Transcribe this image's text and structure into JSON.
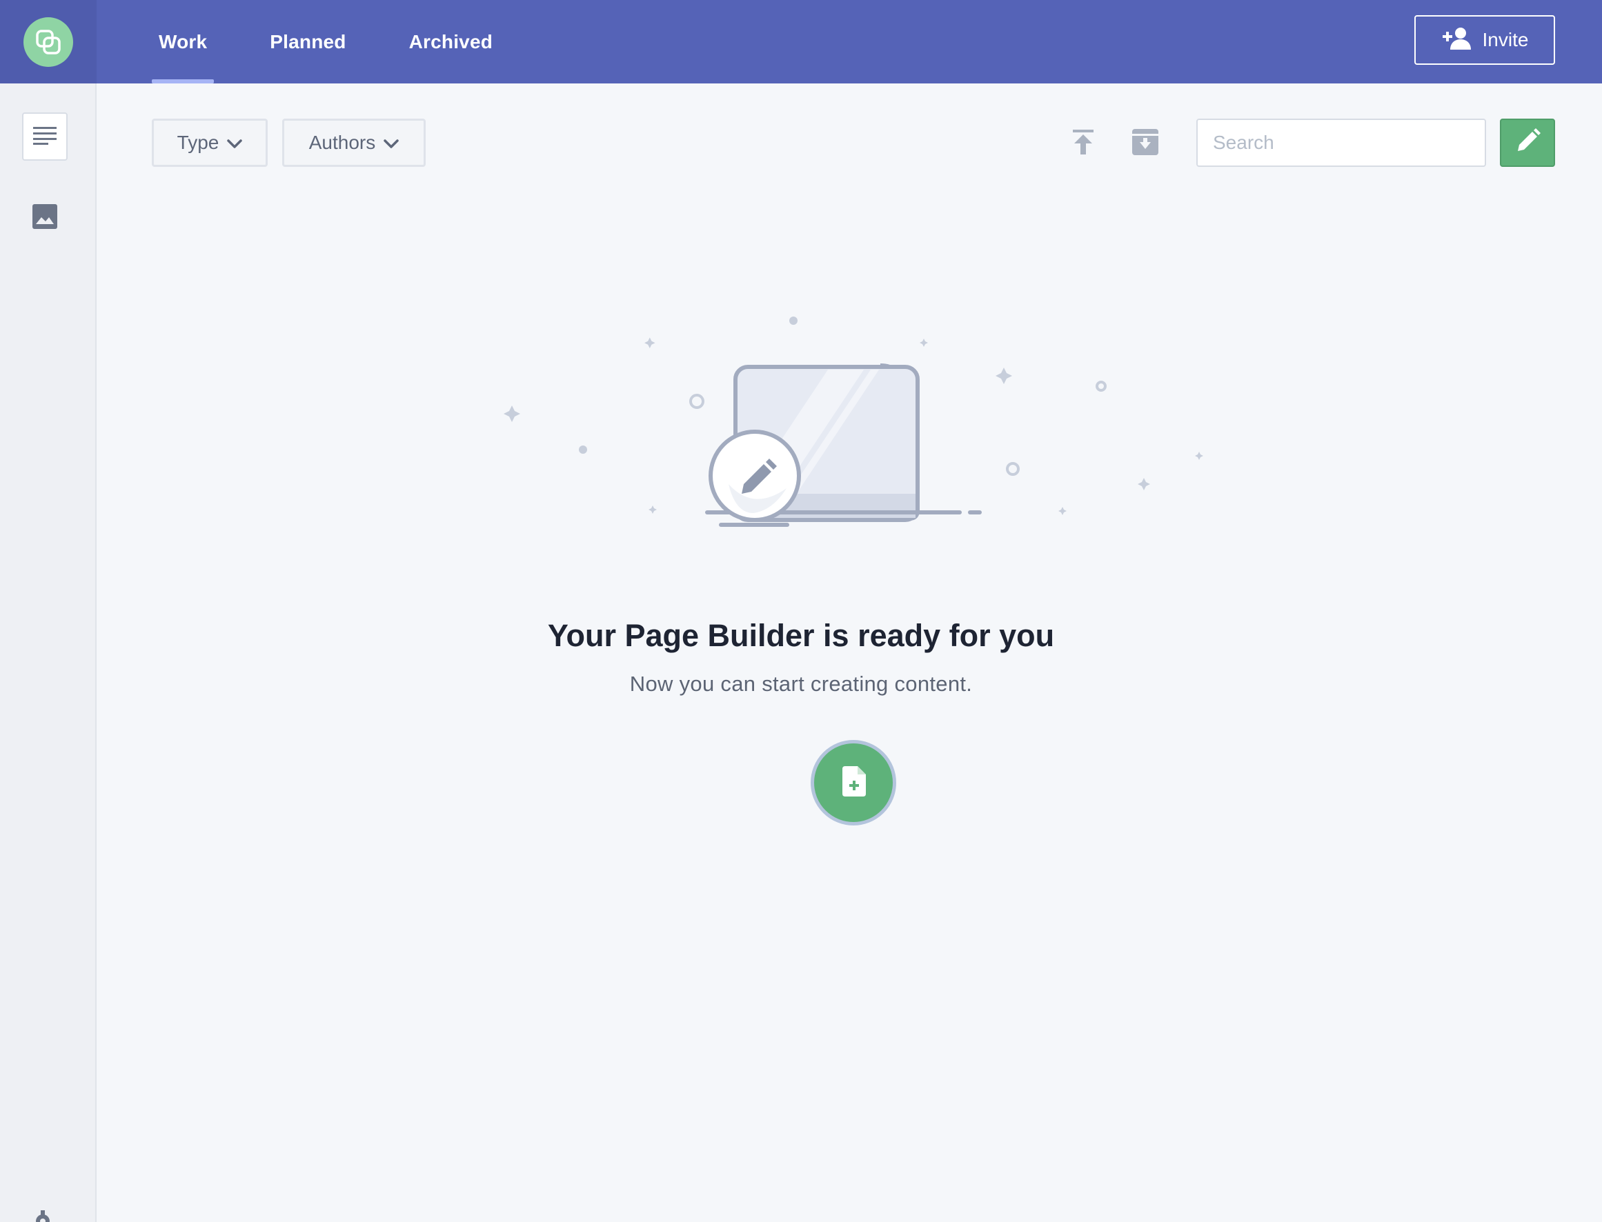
{
  "header": {
    "logo_icon": "brand-logo-icon",
    "tabs": [
      {
        "label": "Work",
        "active": true
      },
      {
        "label": "Planned",
        "active": false
      },
      {
        "label": "Archived",
        "active": false
      }
    ],
    "invite_label": "Invite",
    "invite_icon": "add-user-icon"
  },
  "sidebar": {
    "items": [
      {
        "icon": "list-icon",
        "active": true
      },
      {
        "icon": "image-icon",
        "active": false
      }
    ],
    "bottom_icon": "gear-icon"
  },
  "toolbar": {
    "filters": [
      {
        "label": "Type",
        "icon": "chevron-down-icon"
      },
      {
        "label": "Authors",
        "icon": "chevron-down-icon"
      }
    ],
    "actions": [
      "publish-icon",
      "archive-icon"
    ],
    "search": {
      "placeholder": "Search",
      "value": ""
    },
    "edit_icon": "pencil-icon"
  },
  "empty_state": {
    "title": "Your Page Builder is ready for you",
    "subtitle": "Now you can start creating content.",
    "create_icon": "new-document-icon"
  },
  "colors": {
    "header_bg": "#5563b7",
    "brand_bg": "#4f5cad",
    "accent_green": "#5eb27a",
    "tab_indicator": "#a6b4f5",
    "page_bg": "#f5f7fa"
  }
}
